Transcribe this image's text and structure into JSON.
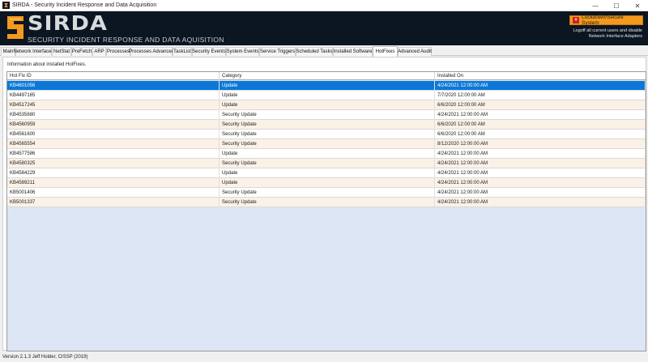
{
  "window": {
    "title": "SIRDA - Security Incident Response and Data Acquisition",
    "minimize_glyph": "—",
    "maximize_glyph": "☐",
    "close_glyph": "✕"
  },
  "banner": {
    "logo_text": "SIRDA",
    "subtitle": "SECURITY INCIDENT RESPONSE AND DATA AQUISITION",
    "lockdown_button": "Lockdown/Secure System",
    "note_line1": "Logoff all current users and disable",
    "note_line2": "Network Interface Adapters"
  },
  "tabs": [
    {
      "label": "Main"
    },
    {
      "label": "Network Interfaces"
    },
    {
      "label": "NetStat"
    },
    {
      "label": "PreFetch"
    },
    {
      "label": "ARP"
    },
    {
      "label": "Processes"
    },
    {
      "label": "Processes Advanced"
    },
    {
      "label": "TaskList"
    },
    {
      "label": "Security Events"
    },
    {
      "label": "System Events"
    },
    {
      "label": "Service Triggers"
    },
    {
      "label": "Scheduled Tasks"
    },
    {
      "label": "Installed Software"
    },
    {
      "label": "HotFixes"
    },
    {
      "label": "Advanced Audit"
    }
  ],
  "active_tab": "HotFixes",
  "content": {
    "info_label": "Information about installed HotFixes.",
    "columns": [
      "Hot Fix ID",
      "Category",
      "Installed On"
    ],
    "rows": [
      {
        "id": "KB4601056",
        "category": "Update",
        "installed": "4/24/2021 12:00:00 AM"
      },
      {
        "id": "KB4497165",
        "category": "Update",
        "installed": "7/7/2020 12:00:00 AM"
      },
      {
        "id": "KB4517245",
        "category": "Update",
        "installed": "6/6/2020 12:00:00 AM"
      },
      {
        "id": "KB4535680",
        "category": "Security Update",
        "installed": "4/24/2021 12:00:00 AM"
      },
      {
        "id": "KB4560959",
        "category": "Security Update",
        "installed": "6/6/2020 12:00:00 AM"
      },
      {
        "id": "KB4561600",
        "category": "Security Update",
        "installed": "6/6/2020 12:00:00 AM"
      },
      {
        "id": "KB4565554",
        "category": "Security Update",
        "installed": "8/12/2020 12:00:00 AM"
      },
      {
        "id": "KB4577586",
        "category": "Update",
        "installed": "4/24/2021 12:00:00 AM"
      },
      {
        "id": "KB4580325",
        "category": "Security Update",
        "installed": "4/24/2021 12:00:00 AM"
      },
      {
        "id": "KB4584229",
        "category": "Update",
        "installed": "4/24/2021 12:00:00 AM"
      },
      {
        "id": "KB4589211",
        "category": "Update",
        "installed": "4/24/2021 12:00:00 AM"
      },
      {
        "id": "KB5001406",
        "category": "Security Update",
        "installed": "4/24/2021 12:00:00 AM"
      },
      {
        "id": "KB5001337",
        "category": "Security Update",
        "installed": "4/24/2021 12:00:00 AM"
      }
    ],
    "selected_row": 0
  },
  "statusbar": {
    "text": "Version 2.1.3  Jeff Holder, CISSP (2019)"
  },
  "colors": {
    "banner_bg": "#0c1522",
    "accent_orange": "#f39a1c",
    "selected_row": "#0b78d7",
    "alt_row": "#fbf1e6",
    "grid_empty": "#dce6f4"
  }
}
